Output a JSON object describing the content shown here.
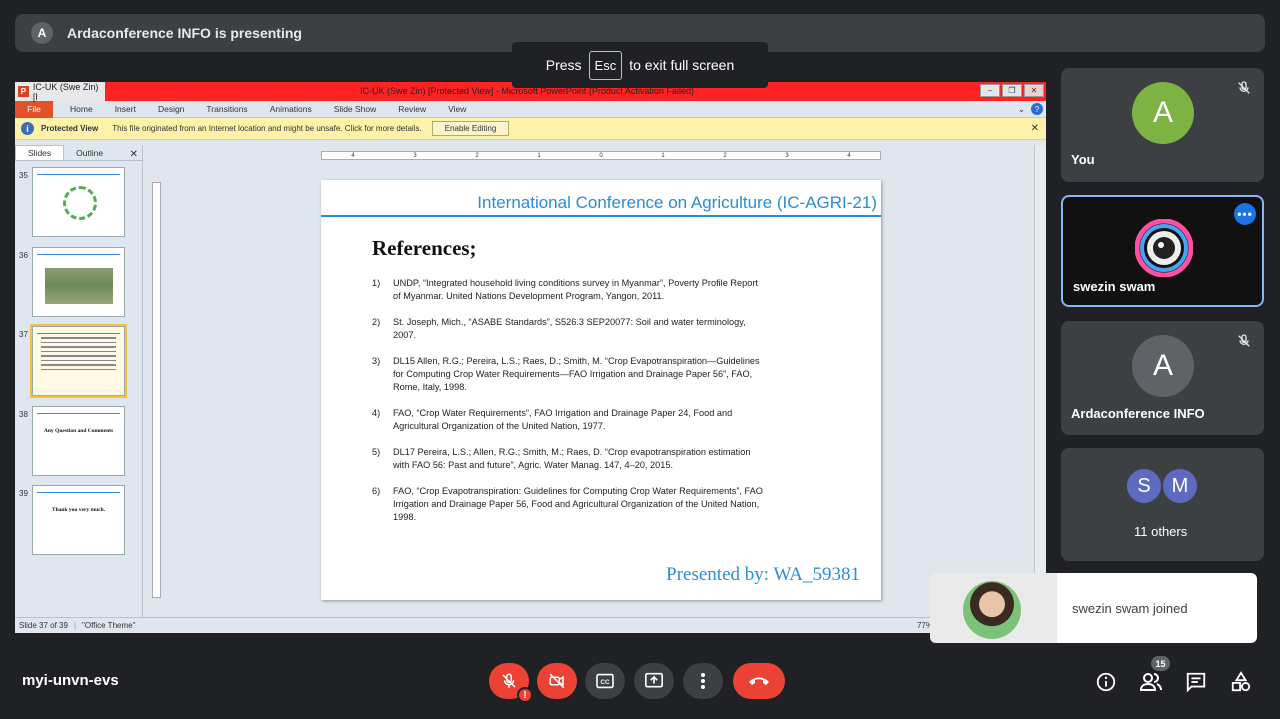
{
  "presenting": {
    "avatar_letter": "A",
    "text": "Ardaconference INFO is presenting"
  },
  "fullscreen_hint": {
    "press": "Press",
    "key": "Esc",
    "rest": "to exit full screen"
  },
  "ppt": {
    "tab_title": "IC-UK (Swe Zin) [I",
    "window_title": "IC-UK (Swe Zin) [Protected View] - Microsoft PowerPoint (Product Activation Failed)",
    "ribbon_tabs": [
      "File",
      "Home",
      "Insert",
      "Design",
      "Transitions",
      "Animations",
      "Slide Show",
      "Review",
      "View"
    ],
    "protected_view": {
      "title": "Protected View",
      "message": "This file originated from an Internet location and might be unsafe. Click for more details.",
      "button": "Enable Editing"
    },
    "panel_tabs": [
      "Slides",
      "Outline"
    ],
    "thumbnails": [
      {
        "num": "35",
        "text": ""
      },
      {
        "num": "36",
        "text": ""
      },
      {
        "num": "37",
        "text": ""
      },
      {
        "num": "38",
        "text": "Any Question and Comments"
      },
      {
        "num": "39",
        "text": "Thank you very much."
      }
    ],
    "slide": {
      "header": "International Conference on Agriculture (IC-AGRI-21)",
      "title": "References;",
      "references": [
        {
          "num": "1)",
          "text": "UNDP, “Integrated household living conditions survey in Myanmar”, Poverty Profile Report of Myanmar. United Nations Development Program, Yangon, 2011."
        },
        {
          "num": "2)",
          "text": "St. Joseph, Mich., “ASABE Standards”, S526.3 SEP20077: Soil and water terminology, 2007."
        },
        {
          "num": "3)",
          "text": "DL15 Allen, R.G.; Pereira, L.S.; Raes, D.; Smith, M. “Crop Evapotranspiration—Guidelines for Computing Crop Water Requirements—FAO Irrigation and Drainage Paper 56”, FAO, Rome, Italy, 1998."
        },
        {
          "num": "4)",
          "text": "FAO, “Crop Water Requirements”, FAO Irrigation and Drainage Paper 24, Food and Agricultural Organization of the United Nation, 1977."
        },
        {
          "num": "5)",
          "text": "DL17 Pereira, L.S.; Allen, R.G.; Smith, M.; Raes, D. “Crop evapotranspiration estimation with FAO 56: Past and future”, Agric. Water Manag. 147, 4–20, 2015."
        },
        {
          "num": "6)",
          "text": "FAO, “Crop Evapotranspiration: Guidelines for Computing Crop Water Requirements”, FAO Irrigation and Drainage Paper 56, Food and Agricultural Organization of the United Nation, 1998."
        }
      ],
      "footer": "Presented by: WA_59381"
    },
    "status": {
      "slide": "Slide 37 of 39",
      "theme": "\"Office Theme\"",
      "zoom": "77%"
    }
  },
  "participants": {
    "you": {
      "letter": "A",
      "name": "You",
      "avatar_color": "#7cb342"
    },
    "active": {
      "name": "swezin swam"
    },
    "arda": {
      "letter": "A",
      "name": "Ardaconference INFO",
      "avatar_color": "#5f6368"
    },
    "others": {
      "letters": [
        "S",
        "M"
      ],
      "label": "11 others"
    }
  },
  "join_toast": {
    "message": "swezin swam joined"
  },
  "meeting": {
    "code": "myi-unvn-evs",
    "participant_count": "15"
  }
}
